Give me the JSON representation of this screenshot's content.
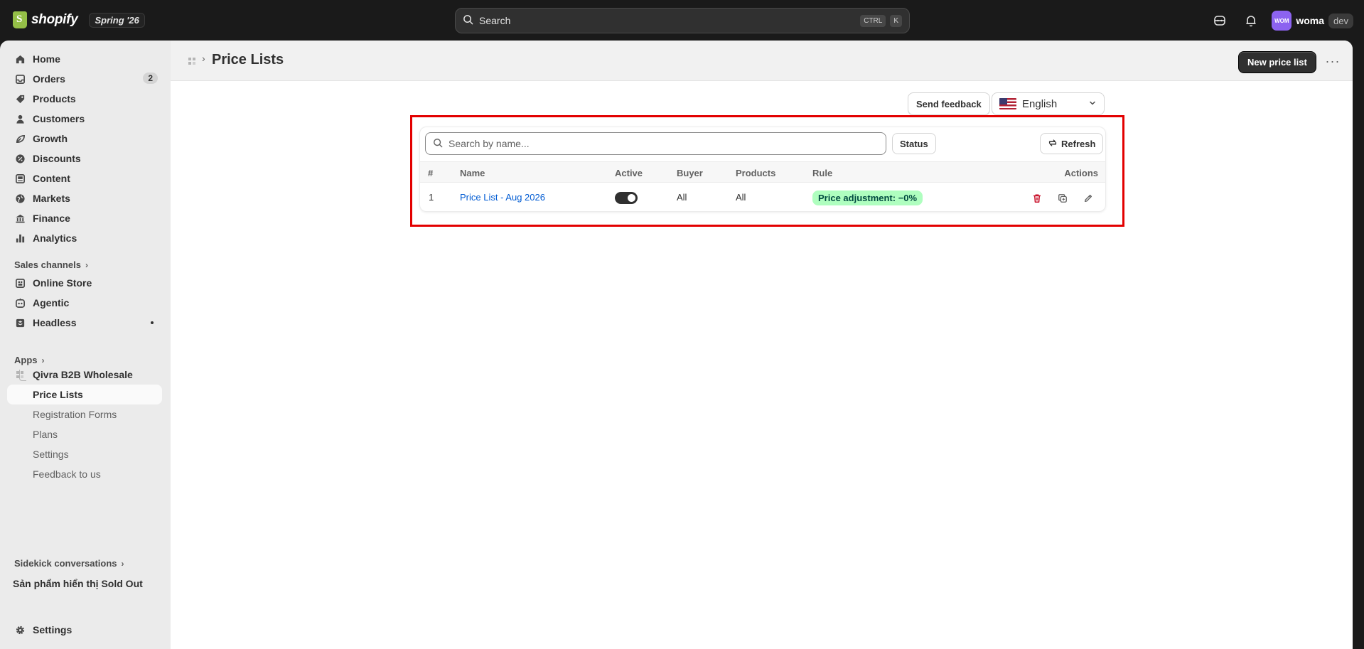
{
  "topbar": {
    "brand": "shopify",
    "edition": "Spring '26",
    "search_placeholder": "Search",
    "shortcut_key1": "CTRL",
    "shortcut_key2": "K",
    "avatar_initials": "WOM",
    "store_name": "woma",
    "env_badge": "dev"
  },
  "sidebar": {
    "items": [
      {
        "label": "Home",
        "icon": "home-icon"
      },
      {
        "label": "Orders",
        "icon": "inbox-icon",
        "badge": "2"
      },
      {
        "label": "Products",
        "icon": "tag-icon"
      },
      {
        "label": "Customers",
        "icon": "person-icon"
      },
      {
        "label": "Growth",
        "icon": "growth-icon"
      },
      {
        "label": "Discounts",
        "icon": "discount-icon"
      },
      {
        "label": "Content",
        "icon": "content-icon"
      },
      {
        "label": "Markets",
        "icon": "globe-icon"
      },
      {
        "label": "Finance",
        "icon": "bank-icon"
      },
      {
        "label": "Analytics",
        "icon": "bar-chart-icon"
      }
    ],
    "sales_channels_label": "Sales channels",
    "channels": [
      {
        "label": "Online Store",
        "icon": "store-icon"
      },
      {
        "label": "Agentic",
        "icon": "agentic-icon"
      },
      {
        "label": "Headless",
        "icon": "headless-icon"
      }
    ],
    "apps_label": "Apps",
    "app_name": "Qivra B2B Wholesale",
    "app_subitems": [
      "Price Lists",
      "Registration Forms",
      "Plans",
      "Settings",
      "Feedback to us"
    ],
    "sidekick_label": "Sidekick conversations",
    "sidekick_item": "Sản phẩm hiển thị Sold Out",
    "settings_label": "Settings"
  },
  "header": {
    "title": "Price Lists",
    "new_button": "New price list",
    "more": "···"
  },
  "toolbar": {
    "feedback_button": "Send feedback",
    "language": "English"
  },
  "table": {
    "search_placeholder": "Search by name...",
    "status_button": "Status",
    "refresh_button": "Refresh",
    "columns": [
      "#",
      "Name",
      "Active",
      "Buyer",
      "Products",
      "Rule",
      "Actions"
    ],
    "rows": [
      {
        "num": "1",
        "name": "Price List - Aug 2026",
        "active": true,
        "buyer": "All",
        "products": "All",
        "rule": "Price adjustment: −0%"
      }
    ]
  },
  "colors": {
    "accent_link": "#005bd3",
    "rule_badge_bg": "#affebf",
    "highlight": "#e30000",
    "avatar": "#8c63f0"
  }
}
